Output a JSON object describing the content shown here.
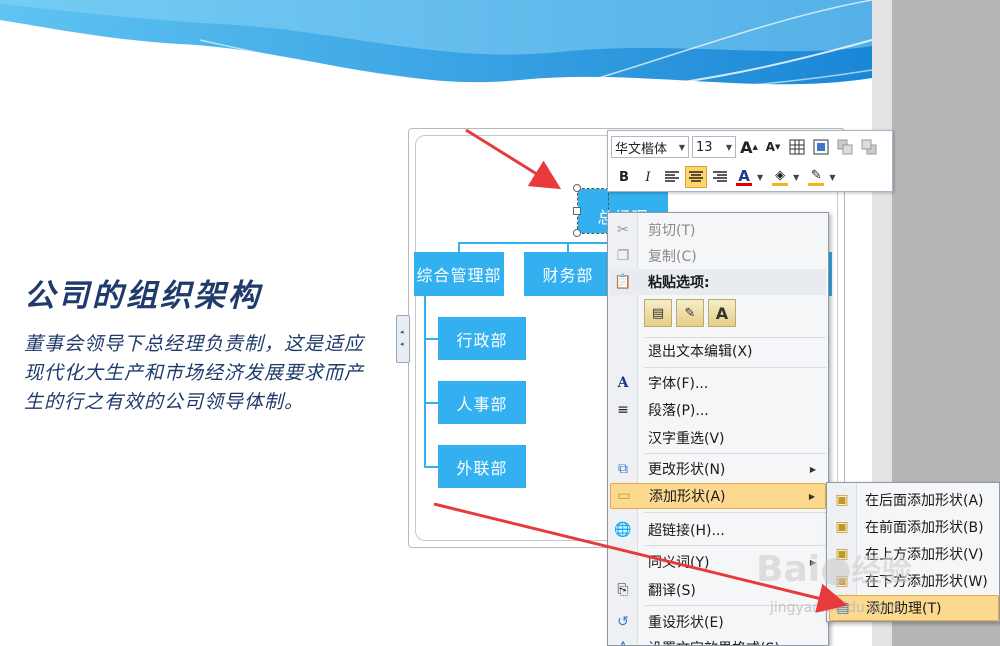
{
  "slide": {
    "title": "公司的组织架构",
    "description": "董事会领导下总经理负责制，这是适应现代化大生产和市场经济发展要求而产生的行之有效的公司领导体制。"
  },
  "org_chart": {
    "top": "总经理",
    "level2": [
      "综合管理部",
      "财务部"
    ],
    "children": [
      "行政部",
      "人事部",
      "外联部"
    ]
  },
  "mini_toolbar": {
    "font_name": "华文楷体",
    "font_size": "13",
    "bold": "B",
    "italic": "I",
    "font_color_glyph": "A",
    "grow_font": "A",
    "shrink_font": "A"
  },
  "context_menu": {
    "items": [
      {
        "label": "剪切(T)",
        "icon": "scissors-icon",
        "enabled": false
      },
      {
        "label": "复制(C)",
        "icon": "copy-icon",
        "enabled": false
      },
      {
        "label": "粘贴选项:",
        "icon": "paste-icon",
        "enabled": true
      },
      {
        "label": "退出文本编辑(X)",
        "icon": "",
        "enabled": true
      },
      {
        "label": "字体(F)...",
        "icon": "font-icon",
        "enabled": true
      },
      {
        "label": "段落(P)...",
        "icon": "paragraph-icon",
        "enabled": true
      },
      {
        "label": "汉字重选(V)",
        "icon": "",
        "enabled": true
      },
      {
        "label": "更改形状(N)",
        "icon": "change-shape-icon",
        "enabled": true
      },
      {
        "label": "添加形状(A)",
        "icon": "add-shape-icon",
        "enabled": true
      },
      {
        "label": "超链接(H)...",
        "icon": "hyperlink-icon",
        "enabled": true
      },
      {
        "label": "同义词(Y)",
        "icon": "",
        "enabled": true
      },
      {
        "label": "翻译(S)",
        "icon": "translate-icon",
        "enabled": true
      },
      {
        "label": "重设形状(E)",
        "icon": "reset-shape-icon",
        "enabled": true
      },
      {
        "label": "设置文字效果格式(S)...",
        "icon": "text-effects-icon",
        "enabled": true
      }
    ],
    "paste_option_letter": "A"
  },
  "submenu": {
    "items": [
      {
        "label": "在后面添加形状(A)"
      },
      {
        "label": "在前面添加形状(B)"
      },
      {
        "label": "在上方添加形状(V)"
      },
      {
        "label": "在下方添加形状(W)"
      },
      {
        "label": "添加助理(T)"
      }
    ]
  },
  "watermark": {
    "brand": "Bai",
    "brand_suffix": "经验",
    "url": "jingyan.baidu.com"
  },
  "colors": {
    "node": "#33b0f0",
    "title": "#1f3a6b",
    "highlight": "#fcd98e",
    "arrow": "#e83a3a"
  }
}
